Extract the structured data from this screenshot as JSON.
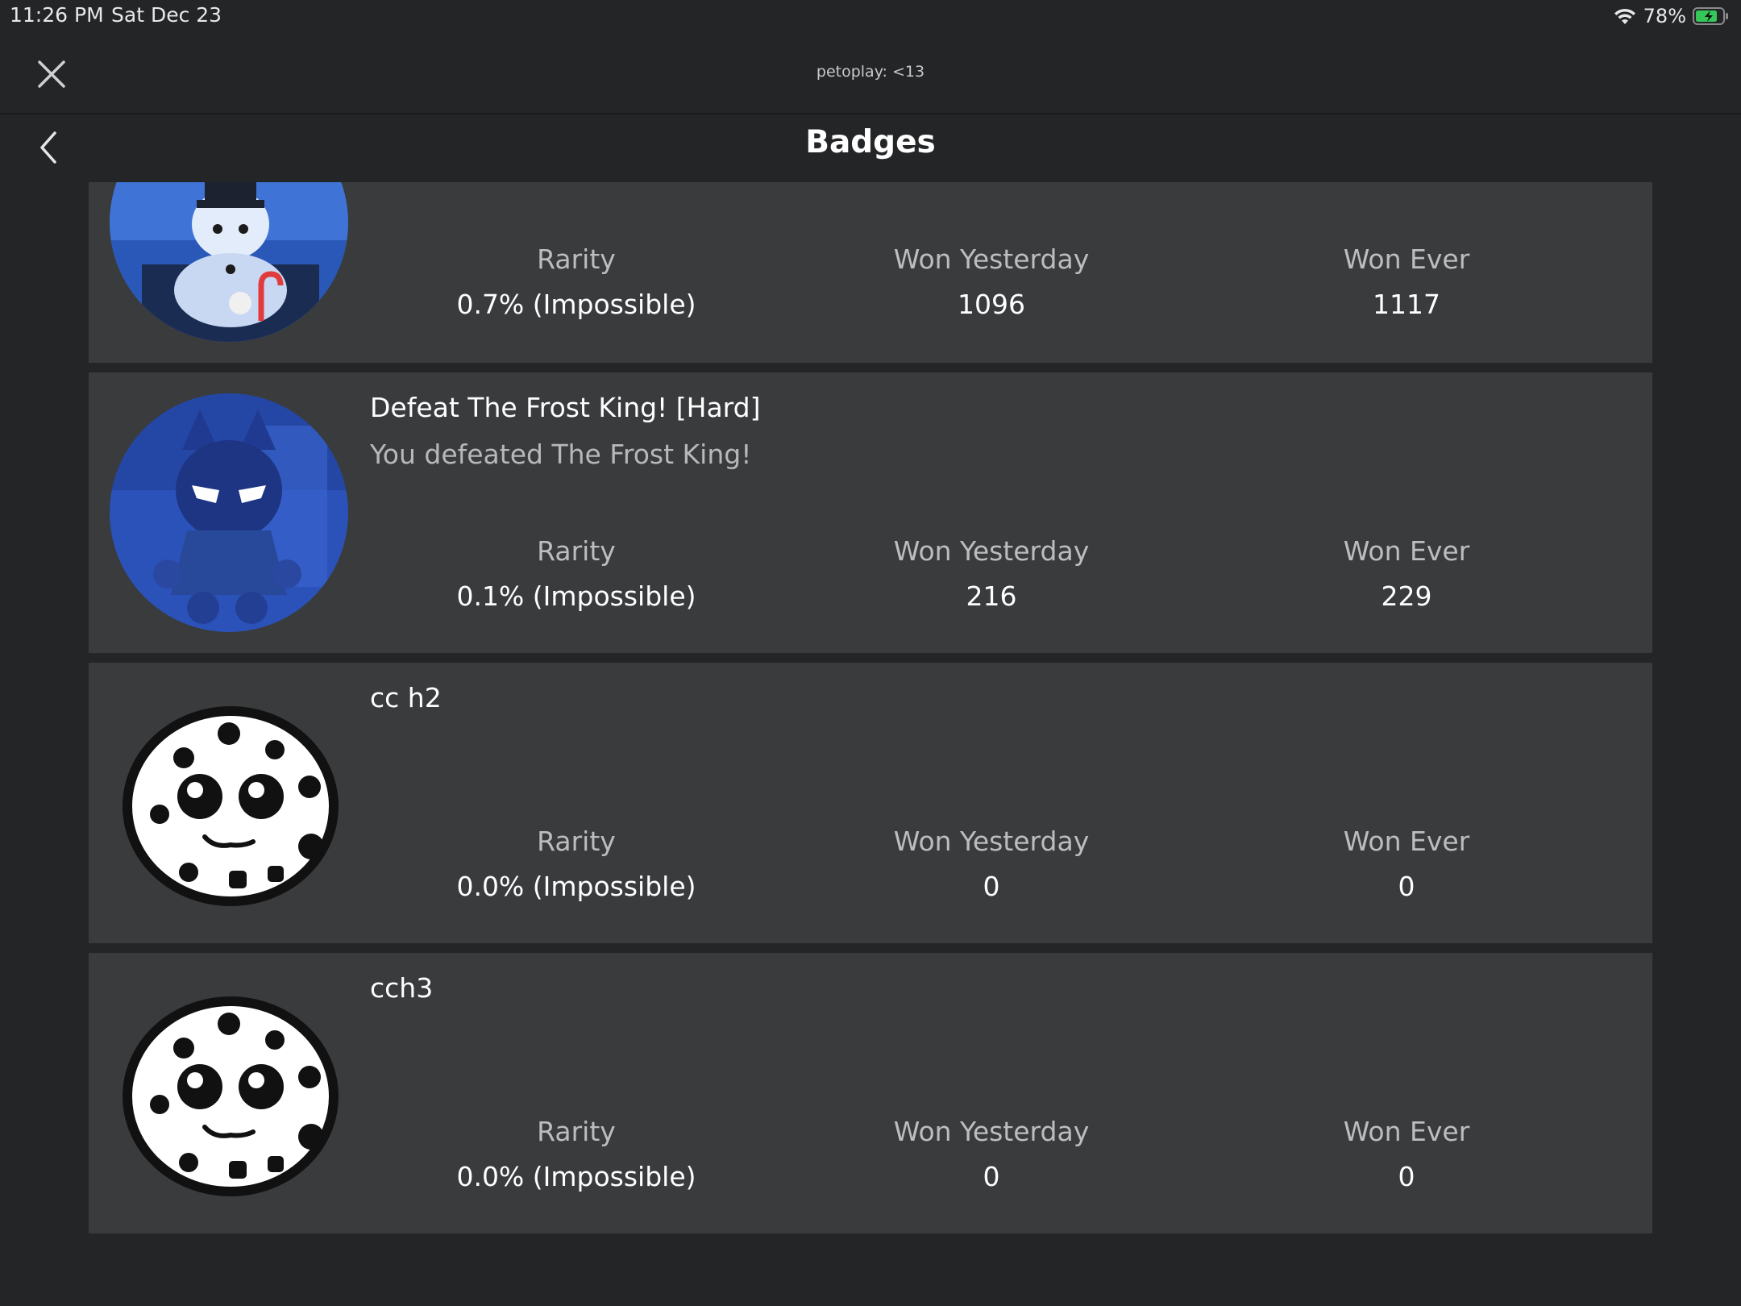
{
  "status_bar": {
    "time": "11:26 PM",
    "date": "Sat Dec 23",
    "battery": "78%"
  },
  "top_bar": {
    "title": "petoplay: <13"
  },
  "header": {
    "title": "Badges"
  },
  "labels": {
    "rarity": "Rarity",
    "won_yesterday": "Won Yesterday",
    "won_ever": "Won Ever"
  },
  "badges": [
    {
      "name": "",
      "description": "",
      "rarity": "0.7% (Impossible)",
      "won_yesterday": "1096",
      "won_ever": "1117"
    },
    {
      "name": "Defeat The Frost King! [Hard]",
      "description": "You defeated The Frost King!",
      "rarity": "0.1% (Impossible)",
      "won_yesterday": "216",
      "won_ever": "229"
    },
    {
      "name": "cc h2",
      "description": "",
      "rarity": "0.0% (Impossible)",
      "won_yesterday": "0",
      "won_ever": "0"
    },
    {
      "name": "cch3",
      "description": "",
      "rarity": "0.0% (Impossible)",
      "won_yesterday": "0",
      "won_ever": "0"
    }
  ]
}
